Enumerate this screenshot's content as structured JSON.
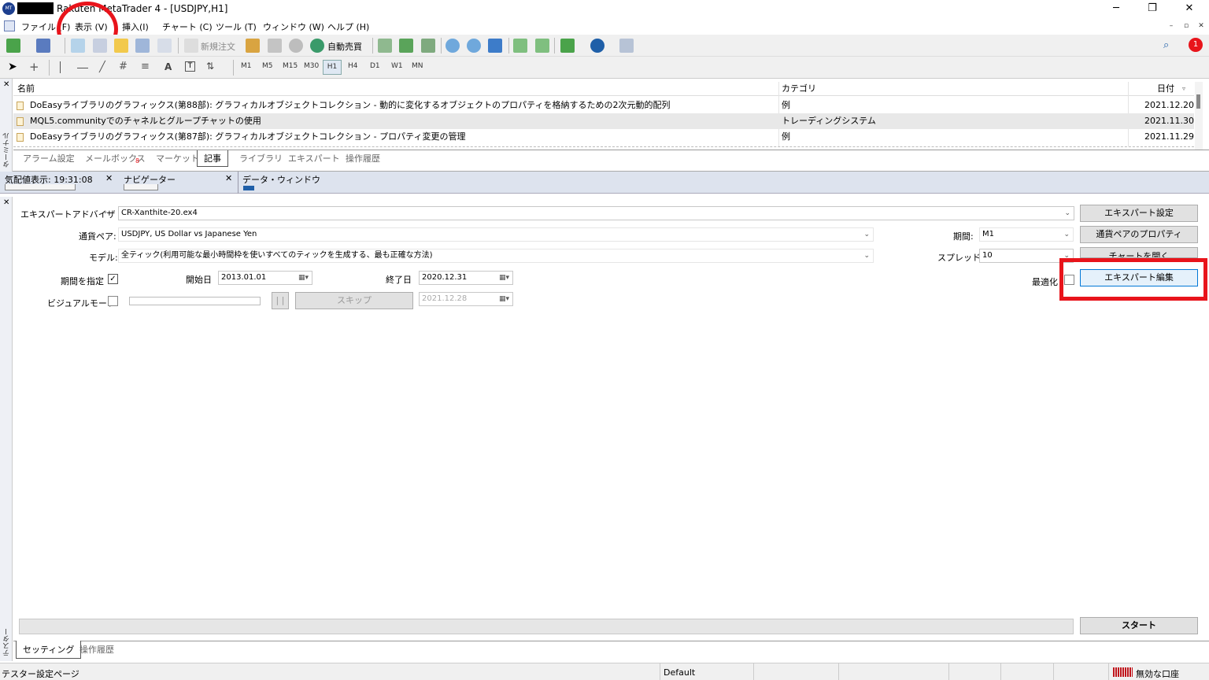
{
  "window": {
    "title": "Rakuten MetaTrader 4 - [USDJPY,H1]",
    "minimize": "─",
    "restore": "❐",
    "close": "✕"
  },
  "menu": {
    "items": [
      "ファイル (F)",
      "表示 (V)",
      "挿入(I)",
      "チャート (C)",
      "ツール (T)",
      "ウィンドウ (W)",
      "ヘルプ (H)"
    ],
    "mdi": [
      "–",
      "▫",
      "✕"
    ]
  },
  "toolbar": {
    "new_order": "新規注文",
    "auto_trading": "自動売買",
    "badge": "1"
  },
  "timeframes": [
    "M1",
    "M5",
    "M15",
    "M30",
    "H1",
    "H4",
    "D1",
    "W1",
    "MN"
  ],
  "terminal": {
    "side_label": "ターミナル",
    "columns": {
      "name": "名前",
      "category": "カテゴリ",
      "date": "日付"
    },
    "rows": [
      {
        "name": "DoEasyライブラリのグラフィックス(第88部): グラフィカルオブジェクトコレクション - 動的に変化するオブジェクトのプロパティを格納するための2次元動的配列",
        "category": "例",
        "date": "2021.12.20"
      },
      {
        "name": "MQL5.communityでのチャネルとグループチャットの使用",
        "category": "トレーディングシステム",
        "date": "2021.11.30"
      },
      {
        "name": "DoEasyライブラリのグラフィックス(第87部): グラフィカルオブジェクトコレクション - プロパティ変更の管理",
        "category": "例",
        "date": "2021.11.29"
      }
    ],
    "tabs": [
      "アラーム設定",
      "メールボックス",
      "マーケット",
      "記事",
      "ライブラリ",
      "エキスパート",
      "操作履歴"
    ],
    "mail_count": "8"
  },
  "panels": {
    "quotes": "気配値表示: 19:31:08",
    "navigator": "ナビゲーター",
    "data_window": "データ・ウィンドウ"
  },
  "tester": {
    "side_label": "テスター",
    "ea_label": "エキスパートアドバイザ",
    "ea_value": "CR-Xanthite-20.ex4",
    "symbol_label": "通貨ペア:",
    "symbol_value": "USDJPY, US Dollar vs Japanese Yen",
    "model_label": "モデル:",
    "model_value": "全ティック(利用可能な最小時間枠を使いすべてのティックを生成する、最も正確な方法)",
    "use_date_label": "期間を指定",
    "start_label": "開始日",
    "start_value": "2013.01.01",
    "end_label": "終了日",
    "end_value": "2020.12.31",
    "visual_label": "ビジュアルモード",
    "pause_label": "| |",
    "skip_label": "スキップ",
    "skip_date": "2021.12.28",
    "period_label": "期間:",
    "period_value": "M1",
    "spread_label": "スプレッド:",
    "spread_value": "10",
    "optimize_label": "最適化",
    "btn_ea_settings": "エキスパート設定",
    "btn_symbol_props": "通貨ペアのプロパティ",
    "btn_open_chart": "チャートを開く",
    "btn_edit_ea": "エキスパート編集",
    "btn_start": "スタート",
    "tabs": [
      "セッティング",
      "操作履歴"
    ]
  },
  "status": {
    "left": "テスター設定ページ",
    "profile": "Default",
    "account": "無効な口座"
  }
}
